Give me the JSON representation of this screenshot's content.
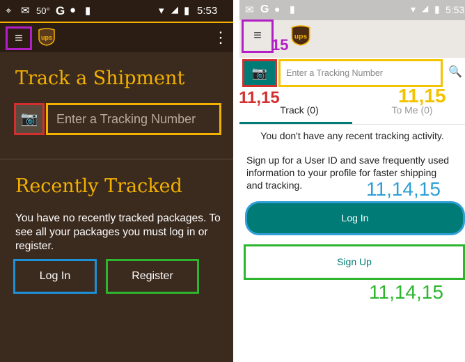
{
  "left": {
    "status": {
      "time": "5:53",
      "temp": "50°",
      "g": "G"
    },
    "header": {
      "menu_icon": "menu-icon",
      "logo_text": "ups",
      "overflow_icon": "more-vert-icon"
    },
    "title": "Track a Shipment",
    "search": {
      "placeholder": "Enter a Tracking Number",
      "camera_icon": "camera-icon"
    },
    "recent_title": "Recently Tracked",
    "message": "You have no recently tracked packages. To see all your packages you must log in or register.",
    "login_label": "Log In",
    "register_label": "Register"
  },
  "right": {
    "status": {
      "time": "5:53",
      "g": "G"
    },
    "header": {
      "menu_icon": "menu-icon",
      "logo_text": "ups"
    },
    "search": {
      "placeholder": "Enter a Tracking Number",
      "camera_icon": "camera-icon",
      "search_icon": "search-icon"
    },
    "tabs": [
      {
        "label": "Track (0)"
      },
      {
        "label": "To Me (0)"
      }
    ],
    "no_recent": "You don't have any recent tracking activity.",
    "signup_text": "Sign up for a User ID and save frequently used information to your profile for faster shipping and tracking.",
    "login_label": "Log In",
    "signup_label": "Sign Up"
  },
  "annotations": {
    "menu": "15",
    "camera": "11,15",
    "input": "11,15",
    "login": "11,14,15",
    "signup": "11,14,15"
  },
  "colors": {
    "ups_brown": "#3b2a1e",
    "ups_gold": "#f3b100",
    "teal": "#007b76"
  }
}
